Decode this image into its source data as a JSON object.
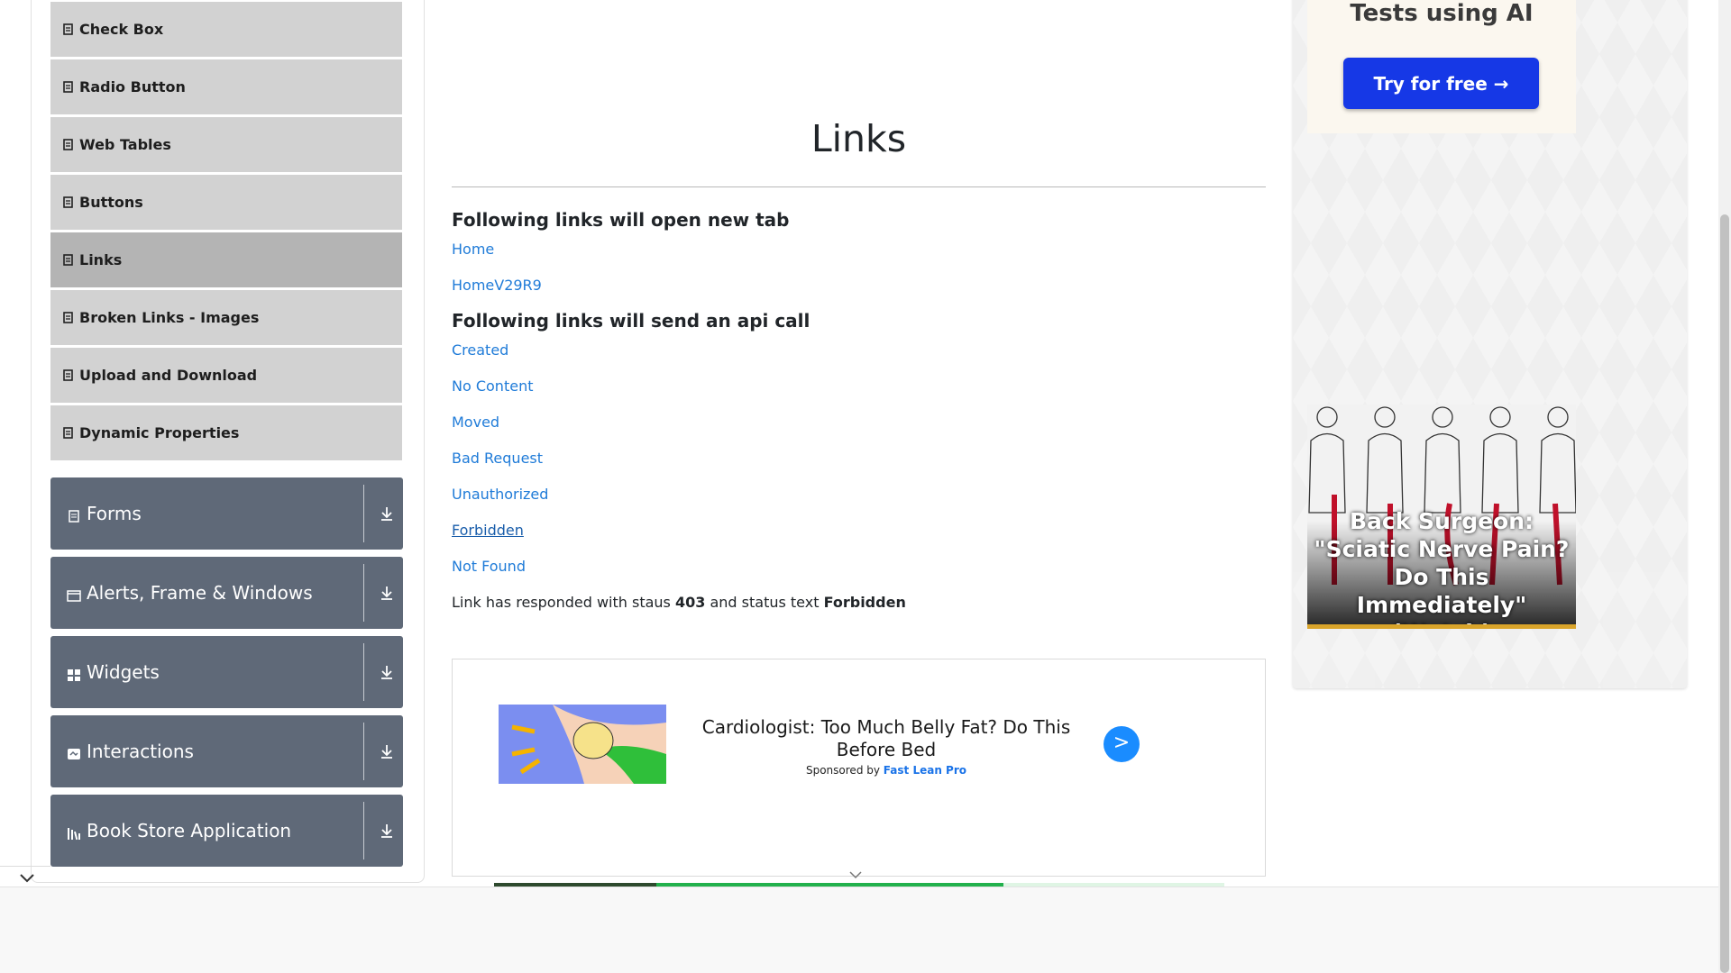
{
  "sidebar": {
    "items": [
      {
        "label": "Check Box"
      },
      {
        "label": "Radio Button"
      },
      {
        "label": "Web Tables"
      },
      {
        "label": "Buttons"
      },
      {
        "label": "Links"
      },
      {
        "label": "Broken Links - Images"
      },
      {
        "label": "Upload and Download"
      },
      {
        "label": "Dynamic Properties"
      }
    ],
    "groups": [
      {
        "label": "Forms"
      },
      {
        "label": "Alerts, Frame & Windows"
      },
      {
        "label": "Widgets"
      },
      {
        "label": "Interactions"
      },
      {
        "label": "Book Store Application"
      }
    ]
  },
  "main": {
    "title": "Links",
    "section_new_tab": "Following links will open new tab",
    "new_tab_links": [
      "Home",
      "HomeV29R9"
    ],
    "section_api": "Following links will send an api call",
    "api_links": [
      "Created",
      "No Content",
      "Moved",
      "Bad Request",
      "Unauthorized",
      "Forbidden",
      "Not Found"
    ],
    "response": {
      "prefix": "Link has responded with staus",
      "status_code": "403",
      "middle": "and status text",
      "status_text": "Forbidden"
    }
  },
  "ad_center": {
    "headline": "Cardiologist: Too Much Belly Fat? Do This Before Bed",
    "sponsored_prefix": "Sponsored by",
    "sponsor": "Fast Lean Pro",
    "go": ">"
  },
  "ad_right": {
    "top_text": "Tests using AI",
    "cta": "Try for free →",
    "surgeon_text": "Back Surgeon: \"Sciatic Nerve Pain? Do This Immediately\" (Watch)"
  },
  "colors": {
    "link": "#1f7bd8",
    "menu_item": "#d2d2d2",
    "menu_active": "#b4b4b4",
    "group": "#5f6978",
    "cta": "#1638e6"
  }
}
